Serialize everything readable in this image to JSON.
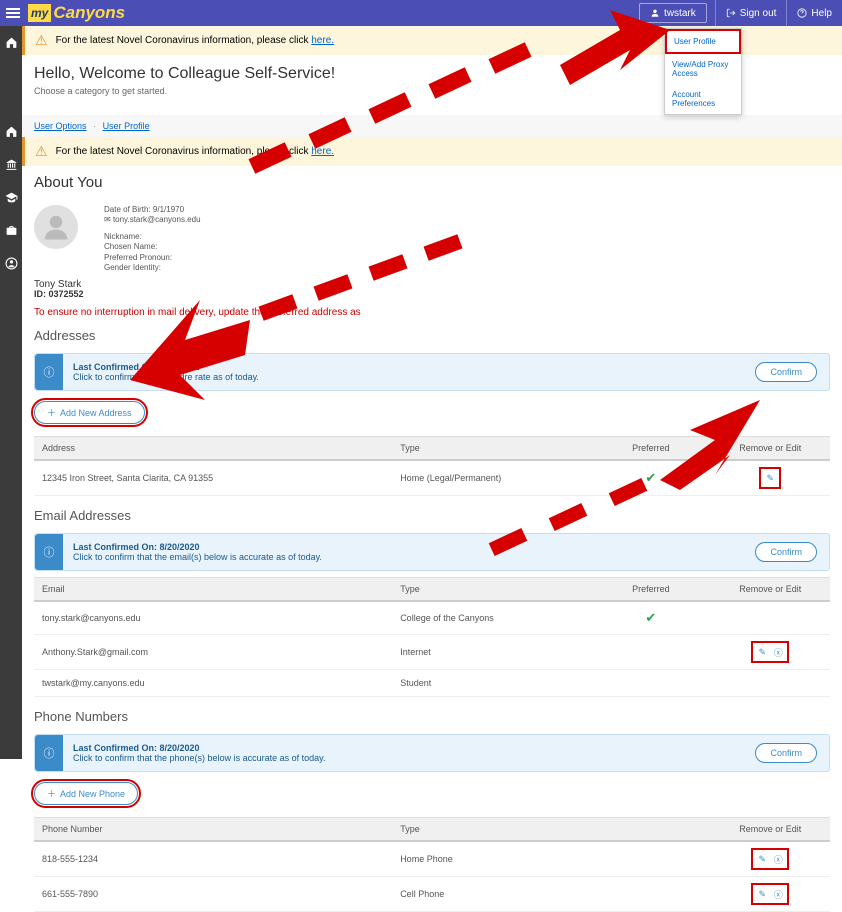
{
  "header": {
    "logo_my": "my",
    "logo_canyons": "Canyons",
    "user": "twstark",
    "signout": "Sign out",
    "help": "Help"
  },
  "alert": {
    "text": "For the latest Novel Coronavirus information, please click ",
    "link": "here."
  },
  "welcome": {
    "title": "Hello, Welcome to Colleague Self-Service!",
    "sub": "Choose a category to get started."
  },
  "dropdown": {
    "item1": "User Profile",
    "item2": "View/Add Proxy Access",
    "item3": "Account Preferences"
  },
  "breadcrumb": {
    "a": "User Options",
    "b": "User Profile"
  },
  "about": {
    "heading": "About You",
    "name": "Tony Stark",
    "id": "ID: 0372552",
    "dob": "Date of Birth: 9/1/1970",
    "email_icon_text": "tony.stark@canyons.edu",
    "labels": {
      "nickname": "Nickname:",
      "chosen": "Chosen Name:",
      "preferred": "Preferred Pronoun:",
      "gender": "Gender Identity:"
    }
  },
  "addresses": {
    "warning": "To ensure no interruption in mail delivery, update the preferred address as ",
    "heading": "Addresses",
    "confirmed": "Last Confirmed On: 3/15/2022",
    "confirm_text": "Click to confirm that the addre                                 rate as of today.",
    "confirm_btn": "Confirm",
    "add_btn": "Add New Address",
    "cols": {
      "a": "Address",
      "b": "Type",
      "c": "Preferred",
      "d": "Remove or Edit"
    },
    "rows": [
      {
        "addr": "12345 Iron Street, Santa Clarita, CA 91355",
        "type": "Home (Legal/Permanent)",
        "pref": true
      }
    ]
  },
  "emails": {
    "heading": "Email Addresses",
    "confirmed": "Last Confirmed On: 8/20/2020",
    "confirm_text": "Click to confirm that the email(s) below is accurate as of today.",
    "confirm_btn": "Confirm",
    "cols": {
      "a": "Email",
      "b": "Type",
      "c": "Preferred",
      "d": "Remove or Edit"
    },
    "rows": [
      {
        "email": "tony.stark@canyons.edu",
        "type": "College of the Canyons",
        "pref": true,
        "edit": false
      },
      {
        "email": "Anthony.Stark@gmail.com",
        "type": "Internet",
        "pref": false,
        "edit": true
      },
      {
        "email": "twstark@my.canyons.edu",
        "type": "Student",
        "pref": false,
        "edit": false
      }
    ]
  },
  "phones": {
    "heading": "Phone Numbers",
    "confirmed": "Last Confirmed On: 8/20/2020",
    "confirm_text": "Click to confirm that the phone(s) below is accurate as of today.",
    "confirm_btn": "Confirm",
    "add_btn": "Add New Phone",
    "cols": {
      "a": "Phone Number",
      "b": "Type",
      "c": "Remove or Edit"
    },
    "rows": [
      {
        "num": "818-555-1234",
        "type": "Home Phone"
      },
      {
        "num": "661-555-7890",
        "type": "Cell Phone"
      }
    ]
  }
}
